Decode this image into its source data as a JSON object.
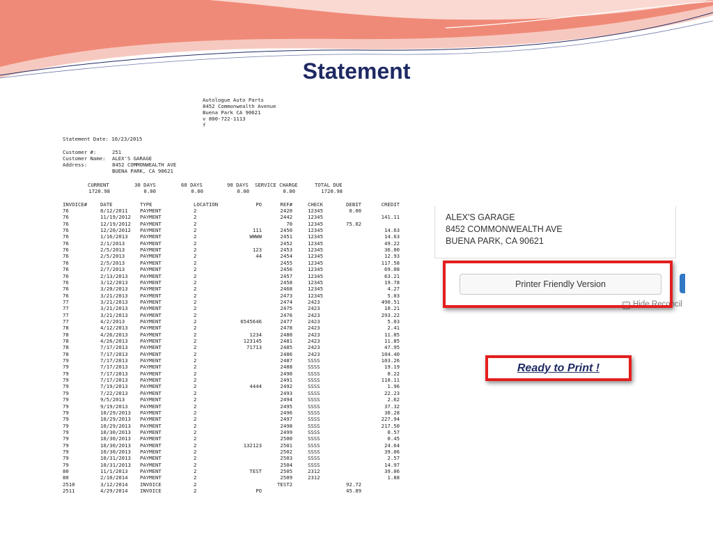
{
  "slide": {
    "title": "Statement"
  },
  "statement": {
    "company": [
      "Autologue Auto Parts",
      "8452 Commonwealth Avenue",
      "Buena Park CA 90621",
      "v 800-722-1113",
      "f"
    ],
    "statement_date": "Statement Date: 10/23/2015",
    "customer_number_label": "Customer #:",
    "customer_number": "251",
    "customer_name_label": "Customer Name:",
    "customer_name": "ALEX'S GARAGE",
    "address_label": "Address:",
    "address_1": "8452 COMMONWEALTH AVE",
    "address_2": "BUENA PARK, CA 90621",
    "aging_headers": [
      "CURRENT",
      "30 DAYS",
      "60 DAYS",
      "90 DAYS",
      "SERVICE CHARGE",
      "TOTAL DUE"
    ],
    "aging_values": [
      "1720.98",
      "0.00",
      "0.00",
      "0.00",
      "0.00",
      "1720.98"
    ],
    "columns": [
      "INVOICE#",
      "DATE",
      "TYPE",
      "LOCATION",
      "PO",
      "REF#",
      "CHECK",
      "DEBIT",
      "CREDIT"
    ],
    "rows": [
      [
        "76",
        "8/12/2011",
        "PAYMENT",
        "2",
        "",
        "2420",
        "12345",
        "0.00",
        ""
      ],
      [
        "76",
        "11/19/2012",
        "PAYMENT",
        "2",
        "",
        "2442",
        "12345",
        "",
        "141.11"
      ],
      [
        "76",
        "12/19/2012",
        "PAYMENT",
        "2",
        "",
        "70",
        "12345",
        "75.02",
        ""
      ],
      [
        "76",
        "12/20/2012",
        "PAYMENT",
        "2",
        "111",
        "2450",
        "12345",
        "",
        "14.63"
      ],
      [
        "76",
        "1/16/2013",
        "PAYMENT",
        "2",
        "WWWW",
        "2451",
        "12345",
        "",
        "14.63"
      ],
      [
        "76",
        "2/1/2013",
        "PAYMENT",
        "2",
        "",
        "2452",
        "12345",
        "",
        "49.22"
      ],
      [
        "76",
        "2/5/2013",
        "PAYMENT",
        "2",
        "123",
        "2453",
        "12345",
        "",
        "36.00"
      ],
      [
        "76",
        "2/5/2013",
        "PAYMENT",
        "2",
        "44",
        "2454",
        "12345",
        "",
        "12.93"
      ],
      [
        "76",
        "2/5/2013",
        "PAYMENT",
        "2",
        "",
        "2455",
        "12345",
        "",
        "117.58"
      ],
      [
        "76",
        "2/7/2013",
        "PAYMENT",
        "2",
        "",
        "2456",
        "12345",
        "",
        "69.08"
      ],
      [
        "76",
        "2/13/2013",
        "PAYMENT",
        "2",
        "",
        "2457",
        "12345",
        "",
        "63.21"
      ],
      [
        "76",
        "3/12/2013",
        "PAYMENT",
        "2",
        "",
        "2458",
        "12345",
        "",
        "19.78"
      ],
      [
        "76",
        "3/20/2013",
        "PAYMENT",
        "2",
        "",
        "2468",
        "12345",
        "",
        "4.27"
      ],
      [
        "76",
        "3/21/2013",
        "PAYMENT",
        "2",
        "",
        "2473",
        "12345",
        "",
        "5.03"
      ],
      [
        "77",
        "3/21/2013",
        "PAYMENT",
        "2",
        "",
        "2474",
        "2423",
        "",
        "490.51"
      ],
      [
        "77",
        "3/21/2013",
        "PAYMENT",
        "2",
        "",
        "2475",
        "2423",
        "",
        "10.21"
      ],
      [
        "77",
        "3/21/2013",
        "PAYMENT",
        "2",
        "",
        "2476",
        "2423",
        "",
        "293.22"
      ],
      [
        "77",
        "4/2/2013",
        "PAYMENT",
        "2",
        "6545646",
        "2477",
        "2423",
        "",
        "5.03"
      ],
      [
        "78",
        "4/12/2013",
        "PAYMENT",
        "2",
        "",
        "2478",
        "2423",
        "",
        "2.41"
      ],
      [
        "78",
        "4/26/2013",
        "PAYMENT",
        "2",
        "1234",
        "2480",
        "2423",
        "",
        "11.85"
      ],
      [
        "78",
        "4/26/2013",
        "PAYMENT",
        "2",
        "123145",
        "2481",
        "2423",
        "",
        "11.85"
      ],
      [
        "78",
        "7/17/2013",
        "PAYMENT",
        "2",
        "71713",
        "2485",
        "2423",
        "",
        "47.95"
      ],
      [
        "78",
        "7/17/2013",
        "PAYMENT",
        "2",
        "",
        "2486",
        "2423",
        "",
        "104.40"
      ],
      [
        "79",
        "7/17/2013",
        "PAYMENT",
        "2",
        "",
        "2487",
        "SSSS",
        "",
        "103.26"
      ],
      [
        "79",
        "7/17/2013",
        "PAYMENT",
        "2",
        "",
        "2488",
        "SSSS",
        "",
        "19.19"
      ],
      [
        "79",
        "7/17/2013",
        "PAYMENT",
        "2",
        "",
        "2490",
        "SSSS",
        "",
        "0.22"
      ],
      [
        "79",
        "7/17/2013",
        "PAYMENT",
        "2",
        "",
        "2491",
        "SSSS",
        "",
        "110.11"
      ],
      [
        "79",
        "7/19/2013",
        "PAYMENT",
        "2",
        "4444",
        "2492",
        "SSSS",
        "",
        "1.96"
      ],
      [
        "79",
        "7/22/2013",
        "PAYMENT",
        "2",
        "",
        "2493",
        "SSSS",
        "",
        "22.23"
      ],
      [
        "79",
        "9/5/2013",
        "PAYMENT",
        "2",
        "",
        "2494",
        "SSSS",
        "",
        "2.62"
      ],
      [
        "79",
        "9/19/2013",
        "PAYMENT",
        "2",
        "",
        "2495",
        "SSSS",
        "",
        "37.32"
      ],
      [
        "79",
        "10/29/2013",
        "PAYMENT",
        "2",
        "",
        "2496",
        "SSSS",
        "",
        "30.28"
      ],
      [
        "79",
        "10/29/2013",
        "PAYMENT",
        "2",
        "",
        "2497",
        "SSSS",
        "",
        "227.94"
      ],
      [
        "79",
        "10/29/2013",
        "PAYMENT",
        "2",
        "",
        "2498",
        "SSSS",
        "",
        "217.50"
      ],
      [
        "79",
        "10/30/2013",
        "PAYMENT",
        "2",
        "",
        "2499",
        "SSSS",
        "",
        "0.57"
      ],
      [
        "79",
        "10/30/2013",
        "PAYMENT",
        "2",
        "",
        "2500",
        "SSSS",
        "",
        "0.45"
      ],
      [
        "79",
        "10/30/2013",
        "PAYMENT",
        "2",
        "132123",
        "2501",
        "SSSS",
        "",
        "24.64"
      ],
      [
        "79",
        "10/30/2013",
        "PAYMENT",
        "2",
        "",
        "2502",
        "SSSS",
        "",
        "39.06"
      ],
      [
        "79",
        "10/31/2013",
        "PAYMENT",
        "2",
        "",
        "2503",
        "SSSS",
        "",
        "2.57"
      ],
      [
        "79",
        "10/31/2013",
        "PAYMENT",
        "2",
        "",
        "2504",
        "SSSS",
        "",
        "14.97"
      ],
      [
        "80",
        "11/1/2013",
        "PAYMENT",
        "2",
        "TEST",
        "2505",
        "2312",
        "",
        "39.06"
      ],
      [
        "80",
        "2/10/2014",
        "PAYMENT",
        "2",
        "",
        "2509",
        "2312",
        "",
        "1.88"
      ],
      [
        "2510",
        "3/12/2014",
        "INVOICE",
        "2",
        "",
        "TEST2",
        "",
        "92.72",
        ""
      ],
      [
        "2511",
        "4/29/2014",
        "INVOICE",
        "2",
        "PO",
        "",
        "",
        "45.89",
        ""
      ]
    ]
  },
  "panel": {
    "address": [
      "ALEX'S GARAGE",
      "8452 COMMONWEALTH AVE",
      "BUENA PARK, CA 90621"
    ],
    "printer_friendly_label": "Printer Friendly Version",
    "hide_reconcile_label": "Hide Reconcil"
  },
  "callout": {
    "ready_label": "Ready to Print !"
  },
  "colors": {
    "title": "#1f2a63",
    "highlight": "#e41e1e",
    "banner_salmon": "#f08a78",
    "banner_pink": "#f6c9c0"
  }
}
